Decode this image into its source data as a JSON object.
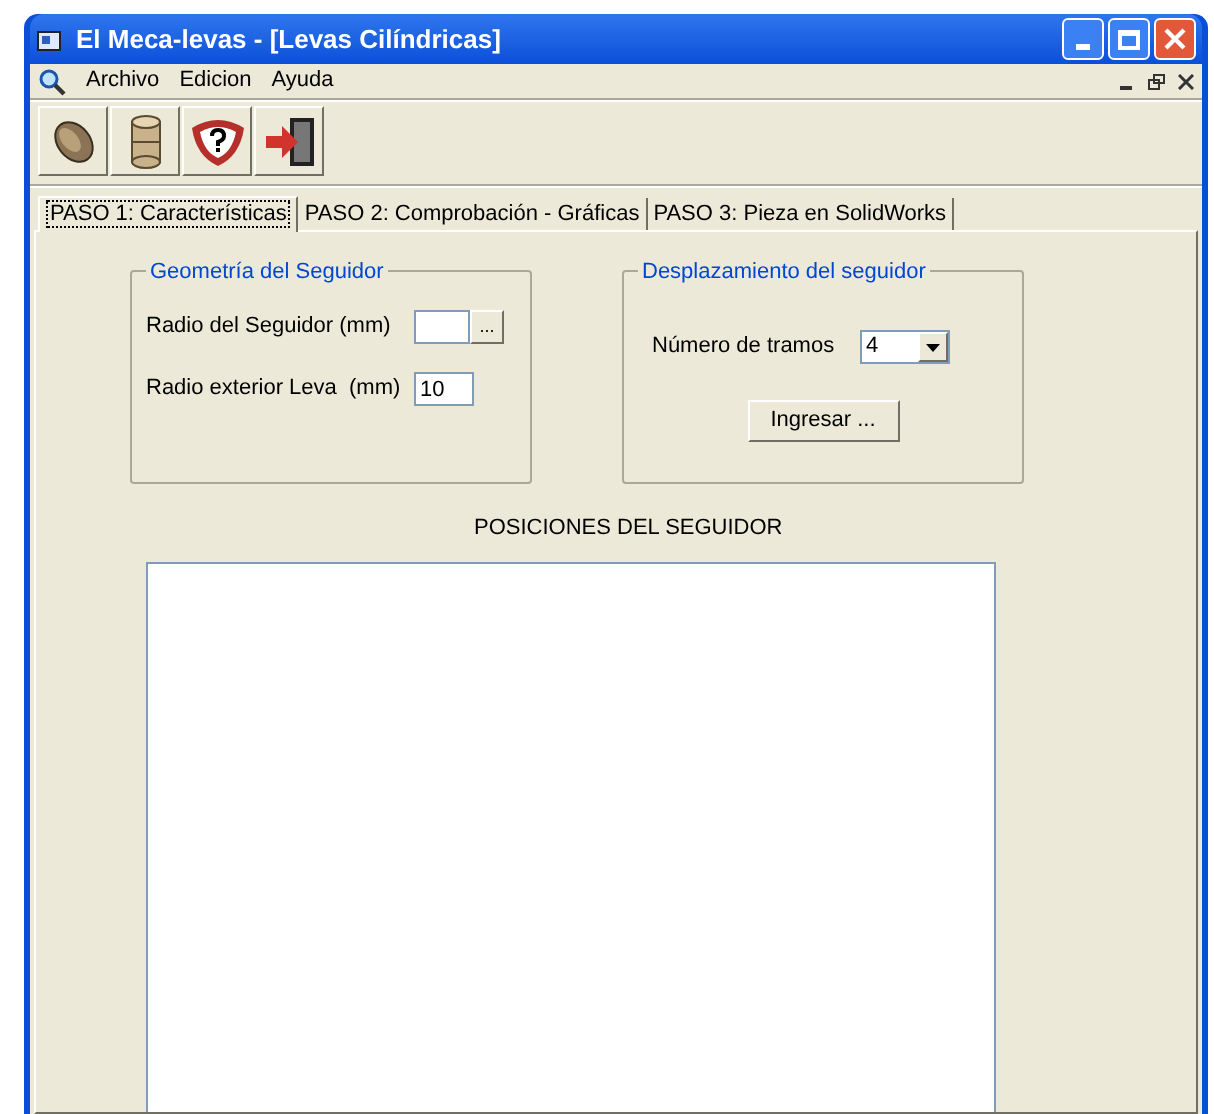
{
  "window": {
    "title": "El Meca-levas - [Levas Cilíndricas]"
  },
  "menu": [
    "Archivo",
    "Edicion",
    "Ayuda"
  ],
  "tabs": [
    {
      "label": "PASO 1: Características",
      "selected": true
    },
    {
      "label": "PASO 2: Comprobación - Gráficas",
      "selected": false
    },
    {
      "label": "PASO 3: Pieza en SolidWorks",
      "selected": false
    }
  ],
  "geometry_group": {
    "title": "Geometría del Seguidor",
    "follower_radius": {
      "label": "Radio del Seguidor (mm)",
      "button": "..."
    },
    "cam_radius": {
      "label": "Radio exterior Leva  (mm)",
      "value": "10"
    }
  },
  "displacement_group": {
    "title": "Desplazamiento del seguidor",
    "segments": {
      "label": "Número de tramos",
      "value": "4"
    },
    "button": "Ingresar ..."
  },
  "positions": {
    "title": "POSICIONES DEL SEGUIDOR"
  }
}
